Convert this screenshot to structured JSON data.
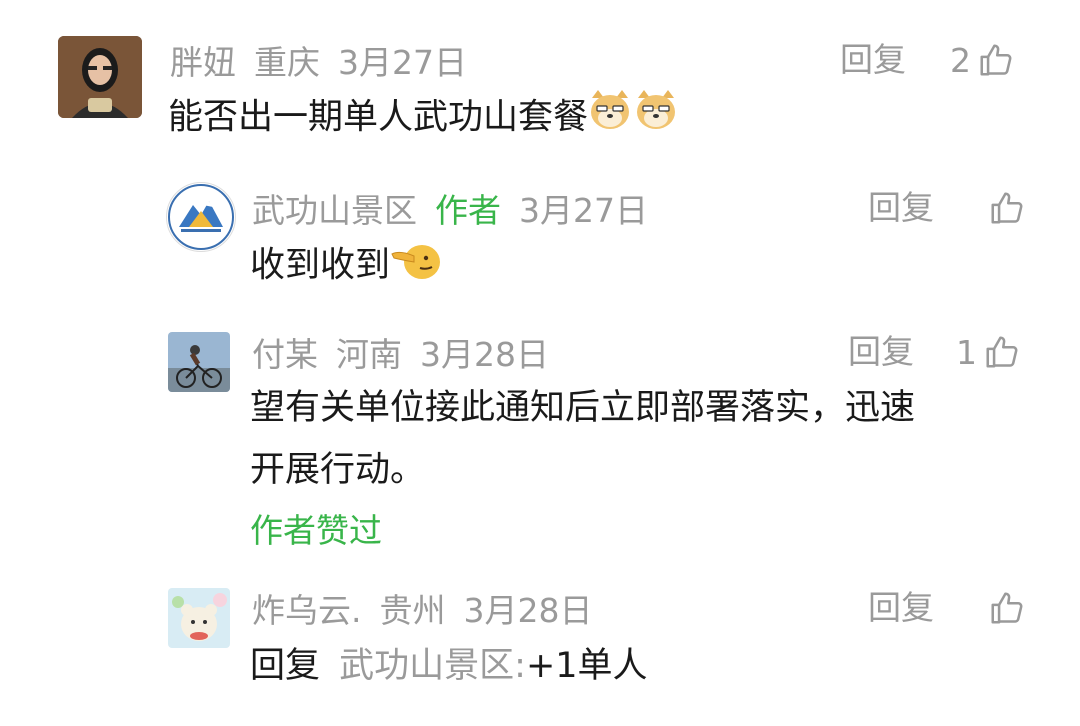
{
  "comments": [
    {
      "name": "胖妞",
      "location": "重庆",
      "date": "3月27日",
      "text": "能否出一期单人武功山套餐",
      "reply_label": "回复",
      "likes": "2",
      "emoji": "doge-icon"
    },
    {
      "name": "武功山景区",
      "author_tag": "作者",
      "date": "3月27日",
      "text": "收到收到",
      "reply_label": "回复",
      "likes": "",
      "emoji": "pointing-face-icon"
    },
    {
      "name": "付某",
      "location": "河南",
      "date": "3月28日",
      "text_line1": "望有关单位接此通知后立即部署落实，迅速",
      "text_line2": "开展行动。",
      "author_liked": "作者赞过",
      "reply_label": "回复",
      "likes": "1"
    },
    {
      "name": "炸乌云.",
      "location": "贵州",
      "date": "3月28日",
      "reply_prefix": "回复",
      "reply_target": "武功山景区:",
      "text": "+1单人",
      "reply_label": "回复",
      "likes": ""
    }
  ],
  "colors": {
    "meta_gray": "#9a9a9a",
    "author_green": "#39b54a",
    "text": "#1a1a1a"
  }
}
